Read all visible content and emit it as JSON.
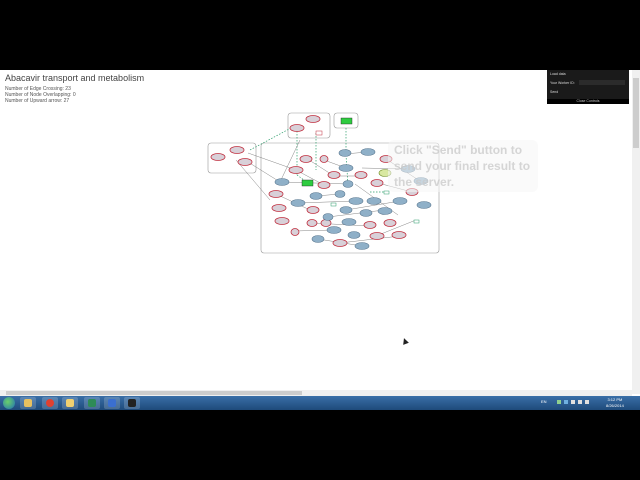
{
  "page": {
    "title": "Abacavir transport and metabolism",
    "stats": [
      "Number of Edge Crossing: 23",
      "Number of Node Overlapping: 0",
      "Number of Upward arrow: 27"
    ]
  },
  "control_panel": {
    "load_data": "Load data",
    "worker_label": "Your Worker ID:",
    "send": "Send",
    "close": "Close Controls"
  },
  "hint": "Click \"Send\" button to send your final result to the server.",
  "clock": {
    "time": "3:12 PM",
    "date": "8/26/2014"
  },
  "tray_lang": "EN",
  "colors": {
    "node_red": "#c03040",
    "node_blue": "#8fb0c8",
    "node_green": "#2ecc40",
    "edge": "#666666",
    "edge_dashed": "#2a9d6a"
  },
  "taskbar_apps": [
    "start-orb",
    "explorer",
    "chrome",
    "folder",
    "excel",
    "word",
    "paint",
    "terminal"
  ]
}
